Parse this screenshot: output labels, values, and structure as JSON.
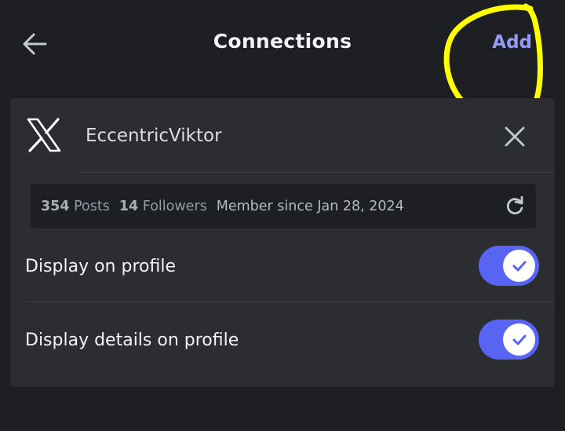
{
  "header": {
    "back_icon": "arrow-left-icon",
    "title": "Connections",
    "add_label": "Add"
  },
  "connection": {
    "service_icon": "x-logo-icon",
    "account_name": "EccentricViktor",
    "remove_icon": "close-icon",
    "stats": {
      "posts_count": "354",
      "posts_label": "Posts",
      "followers_count": "14",
      "followers_label": "Followers",
      "member_since": "Member since Jan 28, 2024",
      "refresh_icon": "refresh-icon"
    },
    "toggles": [
      {
        "label": "Display on profile",
        "enabled": true
      },
      {
        "label": "Display details on profile",
        "enabled": true
      }
    ]
  },
  "colors": {
    "background": "#1e1f22",
    "card": "#2b2d31",
    "accent": "#5865f2",
    "link": "#949cf7",
    "annotation": "#ffff00"
  }
}
